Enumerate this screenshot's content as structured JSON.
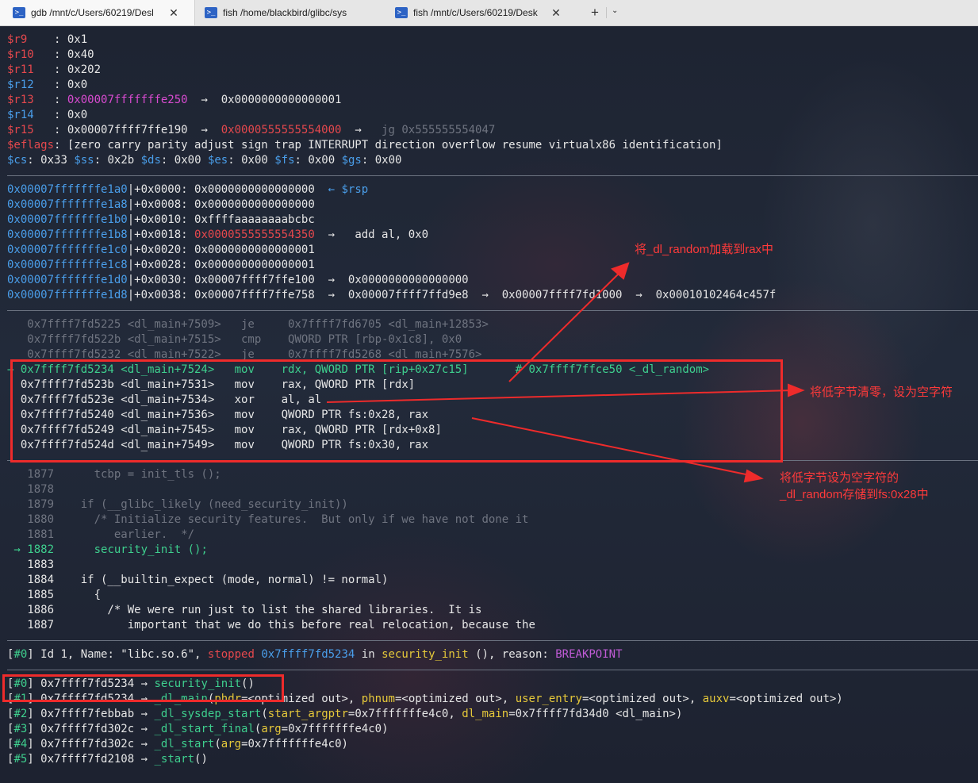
{
  "tabs": [
    {
      "title": "gdb /mnt/c/Users/60219/Desl",
      "icon": "terminal-icon",
      "close": "✕"
    },
    {
      "title": "fish /home/blackbird/glibc/sys",
      "icon": "terminal-icon",
      "close": ""
    },
    {
      "title": "fish  /mnt/c/Users/60219/Desk",
      "icon": "terminal-icon",
      "close": "✕"
    }
  ],
  "tab_controls": {
    "new_tab": "+",
    "dropdown": "⌄"
  },
  "registers": [
    {
      "name": "$r9",
      "val": "0x1"
    },
    {
      "name": "$r10",
      "val": "0x40"
    },
    {
      "name": "$r11",
      "val": "0x202"
    },
    {
      "name": "$r12",
      "val": "0x0"
    },
    {
      "name": "$r13",
      "val": "0x00007fffffffe250",
      "arrow": "→",
      "deref": "0x0000000000000001"
    },
    {
      "name": "$r14",
      "val": "0x0"
    },
    {
      "name": "$r15",
      "val": "0x00007ffff7ffe190",
      "arrow": "→",
      "deref": "0x0000555555554000",
      "arrow2": "→",
      "deref2": "jg 0x555555554047"
    }
  ],
  "eflags": {
    "name": "$eflags",
    "val": "[zero carry parity adjust sign trap INTERRUPT direction overflow resume virtualx86 identification]"
  },
  "segs": [
    {
      "name": "$cs",
      "val": "0x33"
    },
    {
      "name": "$ss",
      "val": "0x2b"
    },
    {
      "name": "$ds",
      "val": "0x00"
    },
    {
      "name": "$es",
      "val": "0x00"
    },
    {
      "name": "$fs",
      "val": "0x00"
    },
    {
      "name": "$gs",
      "val": "0x00"
    }
  ],
  "stack": [
    {
      "addr": "0x00007fffffffe1a0",
      "off": "+0x0000:",
      "val": "0x0000000000000000",
      "tail": "  ← $rsp"
    },
    {
      "addr": "0x00007fffffffe1a8",
      "off": "+0x0008:",
      "val": "0x0000000000000000",
      "tail": ""
    },
    {
      "addr": "0x00007fffffffe1b0",
      "off": "+0x0010:",
      "val": "0xffffaaaaaaaabcbc",
      "tail": ""
    },
    {
      "addr": "0x00007fffffffe1b8",
      "off": "+0x0018:",
      "val": "0x0000555555554350",
      "tail": "  →   add al, 0x0"
    },
    {
      "addr": "0x00007fffffffe1c0",
      "off": "+0x0020:",
      "val": "0x0000000000000001",
      "tail": ""
    },
    {
      "addr": "0x00007fffffffe1c8",
      "off": "+0x0028:",
      "val": "0x0000000000000001",
      "tail": ""
    },
    {
      "addr": "0x00007fffffffe1d0",
      "off": "+0x0030:",
      "val": "0x00007ffff7ffe100",
      "tail": "  →  0x0000000000000000"
    },
    {
      "addr": "0x00007fffffffe1d8",
      "off": "+0x0038:",
      "val": "0x00007ffff7ffe758",
      "tail": "  →  0x00007ffff7ffd9e8  →  0x00007ffff7fd1000  →  0x00010102464c457f"
    }
  ],
  "asm_dim": [
    "   0x7ffff7fd5225 <dl_main+7509>   je     0x7ffff7fd6705 <dl_main+12853>",
    "   0x7ffff7fd522b <dl_main+7515>   cmp    QWORD PTR [rbp-0x1c8], 0x0",
    "   0x7ffff7fd5232 <dl_main+7522>   je     0x7ffff7fd5268 <dl_main+7576>"
  ],
  "asm_current": {
    "marker": "→",
    "addr": "0x7ffff7fd5234 <dl_main+7524>",
    "op": "mov",
    "args": "rdx, QWORD PTR [rip+0x27c15]",
    "comment": "# 0x7ffff7ffce50 <_dl_random>"
  },
  "asm_next": [
    {
      "addr": "0x7ffff7fd523b <dl_main+7531>",
      "op": "mov",
      "args": "rax, QWORD PTR [rdx]"
    },
    {
      "addr": "0x7ffff7fd523e <dl_main+7534>",
      "op": "xor",
      "args": "al, al"
    },
    {
      "addr": "0x7ffff7fd5240 <dl_main+7536>",
      "op": "mov",
      "args": "QWORD PTR fs:0x28, rax"
    },
    {
      "addr": "0x7ffff7fd5249 <dl_main+7545>",
      "op": "mov",
      "args": "rax, QWORD PTR [rdx+0x8]"
    },
    {
      "addr": "0x7ffff7fd524d <dl_main+7549>",
      "op": "mov",
      "args": "QWORD PTR fs:0x30, rax"
    }
  ],
  "source_dim": [
    "   1877      tcbp = init_tls ();",
    "   1878",
    "   1879    if (__glibc_likely (need_security_init))",
    "   1880      /* Initialize security features.  But only if we have not done it",
    "   1881         earlier.  */"
  ],
  "source_current": {
    "marker": "→",
    "num": "1882",
    "code": "      security_init ();"
  },
  "source_after": [
    "   1883",
    "   1884    if (__builtin_expect (mode, normal) != normal)",
    "   1885      {",
    "   1886        /* We were run just to list the shared libraries.  It is",
    "   1887           important that we do this before real relocation, because the"
  ],
  "thread": {
    "idx": "[#0]",
    "text1": " Id 1, Name: \"libc.so.6\", ",
    "stopped": "stopped",
    "addr": "0x7ffff7fd5234",
    "in": " in ",
    "func": "security_init",
    "text2": " (), reason: ",
    "reason": "BREAKPOINT"
  },
  "trace": [
    {
      "idx": "[#0]",
      "addr": "0x7ffff7fd5234",
      "func": "security_init",
      "args": "()"
    },
    {
      "idx": "[#1]",
      "addr": "0x7ffff7fd5234",
      "func": "_dl_main",
      "args": "(phdr=<optimized out>, phnum=<optimized out>, user_entry=<optimized out>, auxv=<optimized out>)"
    },
    {
      "idx": "[#2]",
      "addr": "0x7ffff7febbab",
      "func": "_dl_sysdep_start",
      "args": "(start_argptr=0x7fffffffe4c0, dl_main=0x7ffff7fd34d0 <dl_main>)"
    },
    {
      "idx": "[#3]",
      "addr": "0x7ffff7fd302c",
      "func": "_dl_start_final",
      "args": "(arg=0x7fffffffe4c0)"
    },
    {
      "idx": "[#4]",
      "addr": "0x7ffff7fd302c",
      "func": "_dl_start",
      "args": "(arg=0x7fffffffe4c0)"
    },
    {
      "idx": "[#5]",
      "addr": "0x7ffff7fd2108",
      "func": "_start",
      "args": "()"
    }
  ],
  "annotations": {
    "note1": "将_dl_random加载到rax中",
    "note2": "将低字节清零，设为空字符",
    "note3_line1": "将低字节设为空字符的",
    "note3_line2": "_dl_random存储到fs:0x28中",
    "color": "#ee2b2b"
  }
}
